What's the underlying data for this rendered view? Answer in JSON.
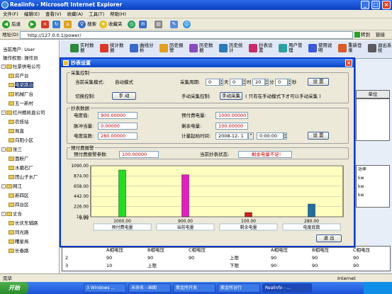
{
  "window": {
    "title": "Realinfo - Microsoft Internet Explorer"
  },
  "menu": [
    "文件(F)",
    "编辑(E)",
    "查看(V)",
    "收藏(A)",
    "工具(T)",
    "帮助(H)"
  ],
  "browser_toolbar": {
    "back": "后退",
    "search": "搜索",
    "favorites": "收藏夹"
  },
  "address": {
    "label": "地址(D)",
    "url": "http://127.0.0.1/power/",
    "go": "转到",
    "links": "链接"
  },
  "left": {
    "current_user": "当前用户: User",
    "operator": "操作权限: 操作员",
    "tree": [
      {
        "label": "杜景供电公司",
        "level": 0,
        "type": "root"
      },
      {
        "label": "房产台",
        "level": 1
      },
      {
        "label": "电梁路台",
        "level": 1,
        "selected": true
      },
      {
        "label": "机械厂台",
        "level": 1
      },
      {
        "label": "五一新村",
        "level": 1
      },
      {
        "label": "红州檀局直公司",
        "level": 0,
        "type": "root"
      },
      {
        "label": "农技站",
        "level": 1
      },
      {
        "label": "局直",
        "level": 1
      },
      {
        "label": "向阳小区",
        "level": 1
      },
      {
        "label": "张三",
        "level": 0,
        "type": "root"
      },
      {
        "label": "面粉厂",
        "level": 1
      },
      {
        "label": "水磨石厂",
        "level": 1
      },
      {
        "label": "团山子水厂",
        "level": 1
      },
      {
        "label": "网江",
        "level": 0,
        "type": "root"
      },
      {
        "label": "新四区",
        "level": 1
      },
      {
        "label": "四台区",
        "level": 1
      },
      {
        "label": "丈合",
        "level": 0,
        "type": "root"
      },
      {
        "label": "长庆东辅路",
        "level": 1
      },
      {
        "label": "同光路",
        "level": 1
      },
      {
        "label": "曙星局",
        "level": 1
      },
      {
        "label": "长春路",
        "level": 1
      }
    ]
  },
  "app_toolbar": [
    {
      "label": "实时数据",
      "color": "#2a8a3a"
    },
    {
      "label": "统计数据",
      "color": "#d83a2a"
    },
    {
      "label": "曲线分析",
      "color": "#3a6ac8"
    },
    {
      "label": "历史报警",
      "color": "#e0a020"
    },
    {
      "label": "历史数据",
      "color": "#8a4ac0"
    },
    {
      "label": "历史统计",
      "color": "#2a7ab8"
    },
    {
      "label": "抄表设置",
      "color": "#c82a6a"
    },
    {
      "label": "用户管理",
      "color": "#2aa0a0"
    },
    {
      "label": "使用说明",
      "color": "#3a5ad8"
    },
    {
      "label": "重新登录",
      "color": "#d85a2a"
    },
    {
      "label": "退出系统",
      "color": "#5a5a5a"
    }
  ],
  "modal": {
    "title": "抄表设置",
    "collect_group": "采集控制",
    "current_mode_label": "当前采集模式:",
    "current_mode_value": "自动模式",
    "period_label": "采集周期:",
    "period_days": "0",
    "days_unit": "天",
    "period_hours": "0",
    "hours_unit": "时",
    "period_minutes": "20",
    "minutes_unit": "分",
    "period_seconds": "0",
    "seconds_unit": "秒",
    "set_button": "设 置",
    "switch_label": "切换控制:",
    "manual_button": "手 动",
    "manual_collect_label": "手动采集控制:",
    "manual_collect_button": "手动采集",
    "manual_hint": "( 只有在手动模式下才可以手动采集 )",
    "meter_group": "抄表数据",
    "power_label": "电度值:",
    "power_value": "900.00000",
    "prepaid_label": "预付费电量:",
    "prepaid_value": "1000.00000",
    "pulse_label": "脉冲当量:",
    "pulse_value": "0.00000",
    "remain_label": "剩余电量:",
    "remain_value": "100.00000",
    "base_label": "电度底数:",
    "base_value": "280.00000",
    "start_time_label": "计量起始时间:",
    "start_date": "2008-12- 1",
    "start_clock": "0:00:00",
    "set_button2": "设 置",
    "prepay_group": "预付费报警",
    "alarm_param_label": "预付费报警参数:",
    "alarm_param_value": "100.00000",
    "meter_status_label": "当前抄表状态:",
    "meter_status_value": "剩余电量不足!",
    "exit_button": "退 出"
  },
  "chart_data": {
    "type": "bar",
    "categories": [
      "预付费电量",
      "当前电量",
      "剩余电量",
      "电度底数"
    ],
    "values": [
      1000,
      900,
      100,
      280
    ],
    "value_labels": [
      "1000.00",
      "900.00",
      "100.00",
      "280.00"
    ],
    "colors": [
      "#22dd22",
      "#e020c0",
      "#d02020",
      "#2070a0"
    ],
    "yticks": [
      "1090.00",
      "874.00",
      "658.00",
      "442.00",
      "226.00",
      "10.00"
    ],
    "ytick_values": [
      1090,
      874,
      658,
      442,
      226,
      10
    ],
    "ymax_label": "9.99",
    "ylim": [
      9.99,
      1090
    ],
    "grid": true,
    "xlabel": "",
    "ylabel": ""
  },
  "background": {
    "header_cols": [
      "单位"
    ],
    "side_labels": [
      "功率",
      "kw",
      "kw",
      "kw"
    ],
    "bottom_row": {
      "cols": [
        "",
        "A相电压",
        "B相电压",
        "C相电压",
        "",
        "A相电压",
        "B相电压",
        "C相电压"
      ],
      "rows": [
        [
          "2",
          "90",
          "90",
          "90",
          "上限",
          "90",
          "90",
          "90"
        ],
        [
          "3",
          "10",
          "上限",
          "",
          "下限",
          "90",
          "90",
          "90"
        ]
      ]
    },
    "upper": "上限",
    "lower": "下限"
  },
  "taskbar": {
    "start": "开始",
    "tasks": [
      "3 Windows ...",
      "未命名 - 画图",
      "紫金所开发",
      "紫金所运行",
      "Realinfo - ..."
    ],
    "internet": "Internet",
    "done": "完毕"
  }
}
